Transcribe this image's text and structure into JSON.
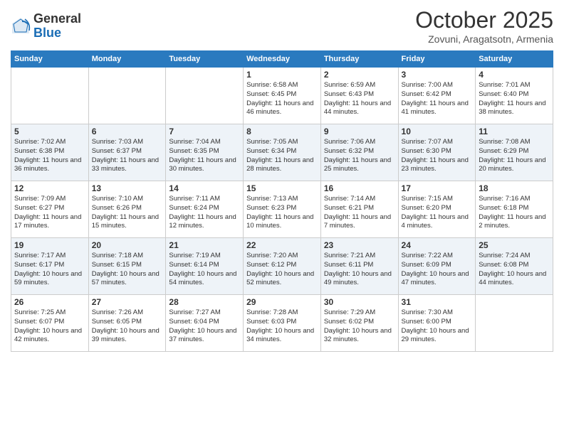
{
  "logo": {
    "general": "General",
    "blue": "Blue"
  },
  "title": "October 2025",
  "subtitle": "Zovuni, Aragatsotn, Armenia",
  "days_of_week": [
    "Sunday",
    "Monday",
    "Tuesday",
    "Wednesday",
    "Thursday",
    "Friday",
    "Saturday"
  ],
  "weeks": [
    [
      {
        "day": "",
        "info": ""
      },
      {
        "day": "",
        "info": ""
      },
      {
        "day": "",
        "info": ""
      },
      {
        "day": "1",
        "info": "Sunrise: 6:58 AM\nSunset: 6:45 PM\nDaylight: 11 hours\nand 46 minutes."
      },
      {
        "day": "2",
        "info": "Sunrise: 6:59 AM\nSunset: 6:43 PM\nDaylight: 11 hours\nand 44 minutes."
      },
      {
        "day": "3",
        "info": "Sunrise: 7:00 AM\nSunset: 6:42 PM\nDaylight: 11 hours\nand 41 minutes."
      },
      {
        "day": "4",
        "info": "Sunrise: 7:01 AM\nSunset: 6:40 PM\nDaylight: 11 hours\nand 38 minutes."
      }
    ],
    [
      {
        "day": "5",
        "info": "Sunrise: 7:02 AM\nSunset: 6:38 PM\nDaylight: 11 hours\nand 36 minutes."
      },
      {
        "day": "6",
        "info": "Sunrise: 7:03 AM\nSunset: 6:37 PM\nDaylight: 11 hours\nand 33 minutes."
      },
      {
        "day": "7",
        "info": "Sunrise: 7:04 AM\nSunset: 6:35 PM\nDaylight: 11 hours\nand 30 minutes."
      },
      {
        "day": "8",
        "info": "Sunrise: 7:05 AM\nSunset: 6:34 PM\nDaylight: 11 hours\nand 28 minutes."
      },
      {
        "day": "9",
        "info": "Sunrise: 7:06 AM\nSunset: 6:32 PM\nDaylight: 11 hours\nand 25 minutes."
      },
      {
        "day": "10",
        "info": "Sunrise: 7:07 AM\nSunset: 6:30 PM\nDaylight: 11 hours\nand 23 minutes."
      },
      {
        "day": "11",
        "info": "Sunrise: 7:08 AM\nSunset: 6:29 PM\nDaylight: 11 hours\nand 20 minutes."
      }
    ],
    [
      {
        "day": "12",
        "info": "Sunrise: 7:09 AM\nSunset: 6:27 PM\nDaylight: 11 hours\nand 17 minutes."
      },
      {
        "day": "13",
        "info": "Sunrise: 7:10 AM\nSunset: 6:26 PM\nDaylight: 11 hours\nand 15 minutes."
      },
      {
        "day": "14",
        "info": "Sunrise: 7:11 AM\nSunset: 6:24 PM\nDaylight: 11 hours\nand 12 minutes."
      },
      {
        "day": "15",
        "info": "Sunrise: 7:13 AM\nSunset: 6:23 PM\nDaylight: 11 hours\nand 10 minutes."
      },
      {
        "day": "16",
        "info": "Sunrise: 7:14 AM\nSunset: 6:21 PM\nDaylight: 11 hours\nand 7 minutes."
      },
      {
        "day": "17",
        "info": "Sunrise: 7:15 AM\nSunset: 6:20 PM\nDaylight: 11 hours\nand 4 minutes."
      },
      {
        "day": "18",
        "info": "Sunrise: 7:16 AM\nSunset: 6:18 PM\nDaylight: 11 hours\nand 2 minutes."
      }
    ],
    [
      {
        "day": "19",
        "info": "Sunrise: 7:17 AM\nSunset: 6:17 PM\nDaylight: 10 hours\nand 59 minutes."
      },
      {
        "day": "20",
        "info": "Sunrise: 7:18 AM\nSunset: 6:15 PM\nDaylight: 10 hours\nand 57 minutes."
      },
      {
        "day": "21",
        "info": "Sunrise: 7:19 AM\nSunset: 6:14 PM\nDaylight: 10 hours\nand 54 minutes."
      },
      {
        "day": "22",
        "info": "Sunrise: 7:20 AM\nSunset: 6:12 PM\nDaylight: 10 hours\nand 52 minutes."
      },
      {
        "day": "23",
        "info": "Sunrise: 7:21 AM\nSunset: 6:11 PM\nDaylight: 10 hours\nand 49 minutes."
      },
      {
        "day": "24",
        "info": "Sunrise: 7:22 AM\nSunset: 6:09 PM\nDaylight: 10 hours\nand 47 minutes."
      },
      {
        "day": "25",
        "info": "Sunrise: 7:24 AM\nSunset: 6:08 PM\nDaylight: 10 hours\nand 44 minutes."
      }
    ],
    [
      {
        "day": "26",
        "info": "Sunrise: 7:25 AM\nSunset: 6:07 PM\nDaylight: 10 hours\nand 42 minutes."
      },
      {
        "day": "27",
        "info": "Sunrise: 7:26 AM\nSunset: 6:05 PM\nDaylight: 10 hours\nand 39 minutes."
      },
      {
        "day": "28",
        "info": "Sunrise: 7:27 AM\nSunset: 6:04 PM\nDaylight: 10 hours\nand 37 minutes."
      },
      {
        "day": "29",
        "info": "Sunrise: 7:28 AM\nSunset: 6:03 PM\nDaylight: 10 hours\nand 34 minutes."
      },
      {
        "day": "30",
        "info": "Sunrise: 7:29 AM\nSunset: 6:02 PM\nDaylight: 10 hours\nand 32 minutes."
      },
      {
        "day": "31",
        "info": "Sunrise: 7:30 AM\nSunset: 6:00 PM\nDaylight: 10 hours\nand 29 minutes."
      },
      {
        "day": "",
        "info": ""
      }
    ]
  ]
}
